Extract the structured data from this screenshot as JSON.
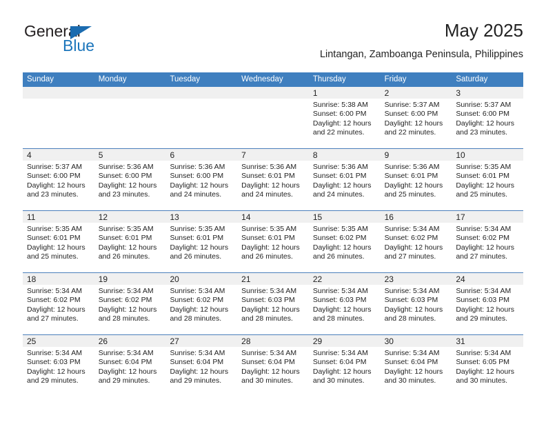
{
  "brand": {
    "name_primary": "General",
    "name_secondary": "Blue",
    "primary_color": "#231f20",
    "accent_color": "#1b75bb",
    "logo_icon": "triangle-flag-icon"
  },
  "header": {
    "title": "May 2025",
    "subtitle": "Lintangan, Zamboanga Peninsula, Philippines"
  },
  "theme": {
    "header_row_bg": "#3f7fbf",
    "header_row_text": "#ffffff",
    "day_number_band_bg": "#f0f0f0",
    "week_separator": "#4a7ebb",
    "cell_bg": "#ffffff",
    "text_color": "#222222"
  },
  "weekdays": [
    "Sunday",
    "Monday",
    "Tuesday",
    "Wednesday",
    "Thursday",
    "Friday",
    "Saturday"
  ],
  "weeks": [
    [
      {
        "day": "",
        "empty": true,
        "sunrise": "",
        "sunset": "",
        "daylight_line1": "",
        "daylight_line2": ""
      },
      {
        "day": "",
        "empty": true,
        "sunrise": "",
        "sunset": "",
        "daylight_line1": "",
        "daylight_line2": ""
      },
      {
        "day": "",
        "empty": true,
        "sunrise": "",
        "sunset": "",
        "daylight_line1": "",
        "daylight_line2": ""
      },
      {
        "day": "",
        "empty": true,
        "sunrise": "",
        "sunset": "",
        "daylight_line1": "",
        "daylight_line2": ""
      },
      {
        "day": "1",
        "empty": false,
        "sunrise": "Sunrise: 5:38 AM",
        "sunset": "Sunset: 6:00 PM",
        "daylight_line1": "Daylight: 12 hours",
        "daylight_line2": "and 22 minutes."
      },
      {
        "day": "2",
        "empty": false,
        "sunrise": "Sunrise: 5:37 AM",
        "sunset": "Sunset: 6:00 PM",
        "daylight_line1": "Daylight: 12 hours",
        "daylight_line2": "and 22 minutes."
      },
      {
        "day": "3",
        "empty": false,
        "sunrise": "Sunrise: 5:37 AM",
        "sunset": "Sunset: 6:00 PM",
        "daylight_line1": "Daylight: 12 hours",
        "daylight_line2": "and 23 minutes."
      }
    ],
    [
      {
        "day": "4",
        "empty": false,
        "sunrise": "Sunrise: 5:37 AM",
        "sunset": "Sunset: 6:00 PM",
        "daylight_line1": "Daylight: 12 hours",
        "daylight_line2": "and 23 minutes."
      },
      {
        "day": "5",
        "empty": false,
        "sunrise": "Sunrise: 5:36 AM",
        "sunset": "Sunset: 6:00 PM",
        "daylight_line1": "Daylight: 12 hours",
        "daylight_line2": "and 23 minutes."
      },
      {
        "day": "6",
        "empty": false,
        "sunrise": "Sunrise: 5:36 AM",
        "sunset": "Sunset: 6:00 PM",
        "daylight_line1": "Daylight: 12 hours",
        "daylight_line2": "and 24 minutes."
      },
      {
        "day": "7",
        "empty": false,
        "sunrise": "Sunrise: 5:36 AM",
        "sunset": "Sunset: 6:01 PM",
        "daylight_line1": "Daylight: 12 hours",
        "daylight_line2": "and 24 minutes."
      },
      {
        "day": "8",
        "empty": false,
        "sunrise": "Sunrise: 5:36 AM",
        "sunset": "Sunset: 6:01 PM",
        "daylight_line1": "Daylight: 12 hours",
        "daylight_line2": "and 24 minutes."
      },
      {
        "day": "9",
        "empty": false,
        "sunrise": "Sunrise: 5:36 AM",
        "sunset": "Sunset: 6:01 PM",
        "daylight_line1": "Daylight: 12 hours",
        "daylight_line2": "and 25 minutes."
      },
      {
        "day": "10",
        "empty": false,
        "sunrise": "Sunrise: 5:35 AM",
        "sunset": "Sunset: 6:01 PM",
        "daylight_line1": "Daylight: 12 hours",
        "daylight_line2": "and 25 minutes."
      }
    ],
    [
      {
        "day": "11",
        "empty": false,
        "sunrise": "Sunrise: 5:35 AM",
        "sunset": "Sunset: 6:01 PM",
        "daylight_line1": "Daylight: 12 hours",
        "daylight_line2": "and 25 minutes."
      },
      {
        "day": "12",
        "empty": false,
        "sunrise": "Sunrise: 5:35 AM",
        "sunset": "Sunset: 6:01 PM",
        "daylight_line1": "Daylight: 12 hours",
        "daylight_line2": "and 26 minutes."
      },
      {
        "day": "13",
        "empty": false,
        "sunrise": "Sunrise: 5:35 AM",
        "sunset": "Sunset: 6:01 PM",
        "daylight_line1": "Daylight: 12 hours",
        "daylight_line2": "and 26 minutes."
      },
      {
        "day": "14",
        "empty": false,
        "sunrise": "Sunrise: 5:35 AM",
        "sunset": "Sunset: 6:01 PM",
        "daylight_line1": "Daylight: 12 hours",
        "daylight_line2": "and 26 minutes."
      },
      {
        "day": "15",
        "empty": false,
        "sunrise": "Sunrise: 5:35 AM",
        "sunset": "Sunset: 6:02 PM",
        "daylight_line1": "Daylight: 12 hours",
        "daylight_line2": "and 26 minutes."
      },
      {
        "day": "16",
        "empty": false,
        "sunrise": "Sunrise: 5:34 AM",
        "sunset": "Sunset: 6:02 PM",
        "daylight_line1": "Daylight: 12 hours",
        "daylight_line2": "and 27 minutes."
      },
      {
        "day": "17",
        "empty": false,
        "sunrise": "Sunrise: 5:34 AM",
        "sunset": "Sunset: 6:02 PM",
        "daylight_line1": "Daylight: 12 hours",
        "daylight_line2": "and 27 minutes."
      }
    ],
    [
      {
        "day": "18",
        "empty": false,
        "sunrise": "Sunrise: 5:34 AM",
        "sunset": "Sunset: 6:02 PM",
        "daylight_line1": "Daylight: 12 hours",
        "daylight_line2": "and 27 minutes."
      },
      {
        "day": "19",
        "empty": false,
        "sunrise": "Sunrise: 5:34 AM",
        "sunset": "Sunset: 6:02 PM",
        "daylight_line1": "Daylight: 12 hours",
        "daylight_line2": "and 28 minutes."
      },
      {
        "day": "20",
        "empty": false,
        "sunrise": "Sunrise: 5:34 AM",
        "sunset": "Sunset: 6:02 PM",
        "daylight_line1": "Daylight: 12 hours",
        "daylight_line2": "and 28 minutes."
      },
      {
        "day": "21",
        "empty": false,
        "sunrise": "Sunrise: 5:34 AM",
        "sunset": "Sunset: 6:03 PM",
        "daylight_line1": "Daylight: 12 hours",
        "daylight_line2": "and 28 minutes."
      },
      {
        "day": "22",
        "empty": false,
        "sunrise": "Sunrise: 5:34 AM",
        "sunset": "Sunset: 6:03 PM",
        "daylight_line1": "Daylight: 12 hours",
        "daylight_line2": "and 28 minutes."
      },
      {
        "day": "23",
        "empty": false,
        "sunrise": "Sunrise: 5:34 AM",
        "sunset": "Sunset: 6:03 PM",
        "daylight_line1": "Daylight: 12 hours",
        "daylight_line2": "and 28 minutes."
      },
      {
        "day": "24",
        "empty": false,
        "sunrise": "Sunrise: 5:34 AM",
        "sunset": "Sunset: 6:03 PM",
        "daylight_line1": "Daylight: 12 hours",
        "daylight_line2": "and 29 minutes."
      }
    ],
    [
      {
        "day": "25",
        "empty": false,
        "sunrise": "Sunrise: 5:34 AM",
        "sunset": "Sunset: 6:03 PM",
        "daylight_line1": "Daylight: 12 hours",
        "daylight_line2": "and 29 minutes."
      },
      {
        "day": "26",
        "empty": false,
        "sunrise": "Sunrise: 5:34 AM",
        "sunset": "Sunset: 6:04 PM",
        "daylight_line1": "Daylight: 12 hours",
        "daylight_line2": "and 29 minutes."
      },
      {
        "day": "27",
        "empty": false,
        "sunrise": "Sunrise: 5:34 AM",
        "sunset": "Sunset: 6:04 PM",
        "daylight_line1": "Daylight: 12 hours",
        "daylight_line2": "and 29 minutes."
      },
      {
        "day": "28",
        "empty": false,
        "sunrise": "Sunrise: 5:34 AM",
        "sunset": "Sunset: 6:04 PM",
        "daylight_line1": "Daylight: 12 hours",
        "daylight_line2": "and 30 minutes."
      },
      {
        "day": "29",
        "empty": false,
        "sunrise": "Sunrise: 5:34 AM",
        "sunset": "Sunset: 6:04 PM",
        "daylight_line1": "Daylight: 12 hours",
        "daylight_line2": "and 30 minutes."
      },
      {
        "day": "30",
        "empty": false,
        "sunrise": "Sunrise: 5:34 AM",
        "sunset": "Sunset: 6:04 PM",
        "daylight_line1": "Daylight: 12 hours",
        "daylight_line2": "and 30 minutes."
      },
      {
        "day": "31",
        "empty": false,
        "sunrise": "Sunrise: 5:34 AM",
        "sunset": "Sunset: 6:05 PM",
        "daylight_line1": "Daylight: 12 hours",
        "daylight_line2": "and 30 minutes."
      }
    ]
  ]
}
